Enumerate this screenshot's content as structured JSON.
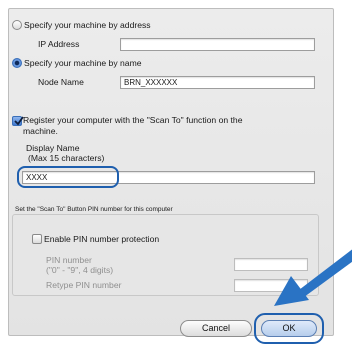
{
  "address_section": {
    "radio_label": "Specify your machine by address",
    "ip_label": "IP Address",
    "ip_value": ""
  },
  "name_section": {
    "radio_label": "Specify your machine by name",
    "node_label": "Node Name",
    "node_value": "BRN_XXXXXX"
  },
  "register_section": {
    "checkbox_label_line1": "Register your computer with the \"Scan To\" function on the",
    "checkbox_label_line2": "machine.",
    "display_name_label": "Display Name",
    "display_name_hint": "(Max 15 characters)",
    "display_name_value": "XXXX"
  },
  "pin_section": {
    "group_title": "Set the \"Scan To\" Button PIN number for this computer",
    "enable_label": "Enable PIN number protection",
    "pin_label": "PIN number",
    "pin_hint": "(\"0\" - \"9\",  4 digits)",
    "pin_value": "",
    "retype_label": "Retype PIN number",
    "retype_value": ""
  },
  "buttons": {
    "cancel_label": "Cancel",
    "ok_label": "OK"
  },
  "colors": {
    "highlight": "#1f5fae",
    "arrow": "#2a73c4"
  }
}
